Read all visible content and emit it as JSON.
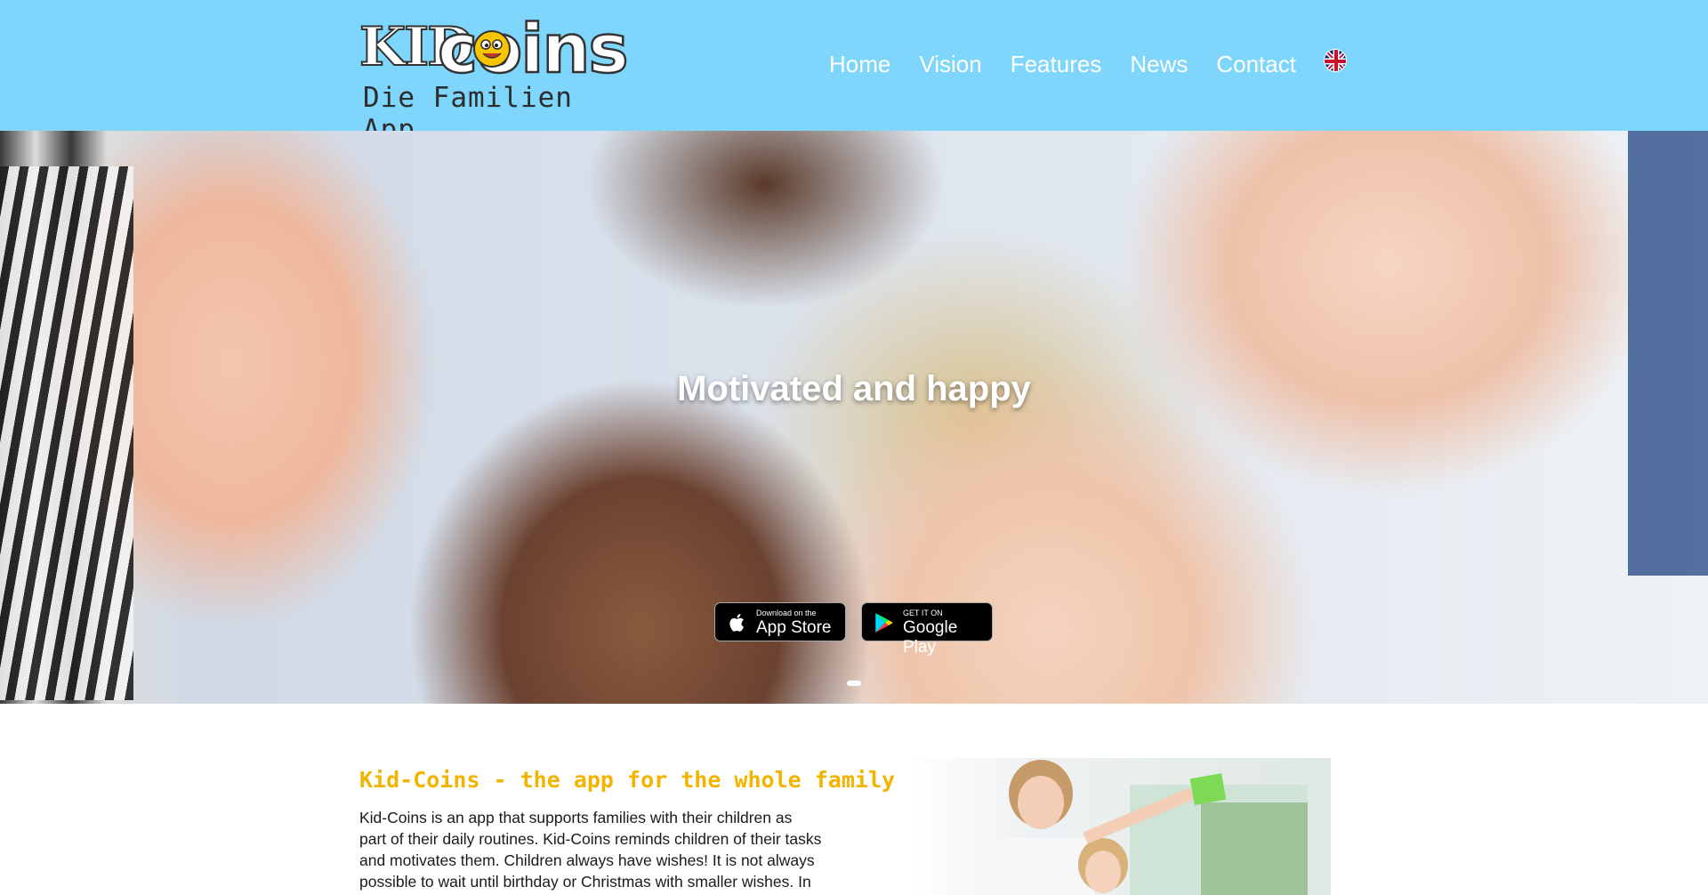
{
  "brand": {
    "logo_main_left": "KID",
    "logo_main_right": "coins",
    "logo_sub": "Die Familien App",
    "colors": {
      "header_bg": "#7fd6fd",
      "accent_yellow": "#f3b400",
      "nav_text": "#ffffff"
    }
  },
  "nav": {
    "items": [
      {
        "label": "Home"
      },
      {
        "label": "Vision"
      },
      {
        "label": "Features"
      },
      {
        "label": "News"
      },
      {
        "label": "Contact"
      }
    ],
    "language_icon": "uk-flag-icon"
  },
  "hero": {
    "title": "Motivated and happy",
    "app_store": {
      "small": "Download on the",
      "big": "App Store",
      "icon": "apple-icon"
    },
    "google_play": {
      "small": "GET IT ON",
      "big": "Google Play",
      "icon": "google-play-icon"
    },
    "slides_total": 1,
    "active_slide": 1
  },
  "section": {
    "heading": "Kid-Coins - the app for the whole family",
    "lines": [
      "Kid-Coins is an app that supports families with their children as",
      "part of their daily routines. Kid-Coins reminds children of their tasks",
      "and motivates them. Children always have wishes! It is not always",
      "possible to wait until birthday or Christmas with smaller wishes. In"
    ]
  }
}
